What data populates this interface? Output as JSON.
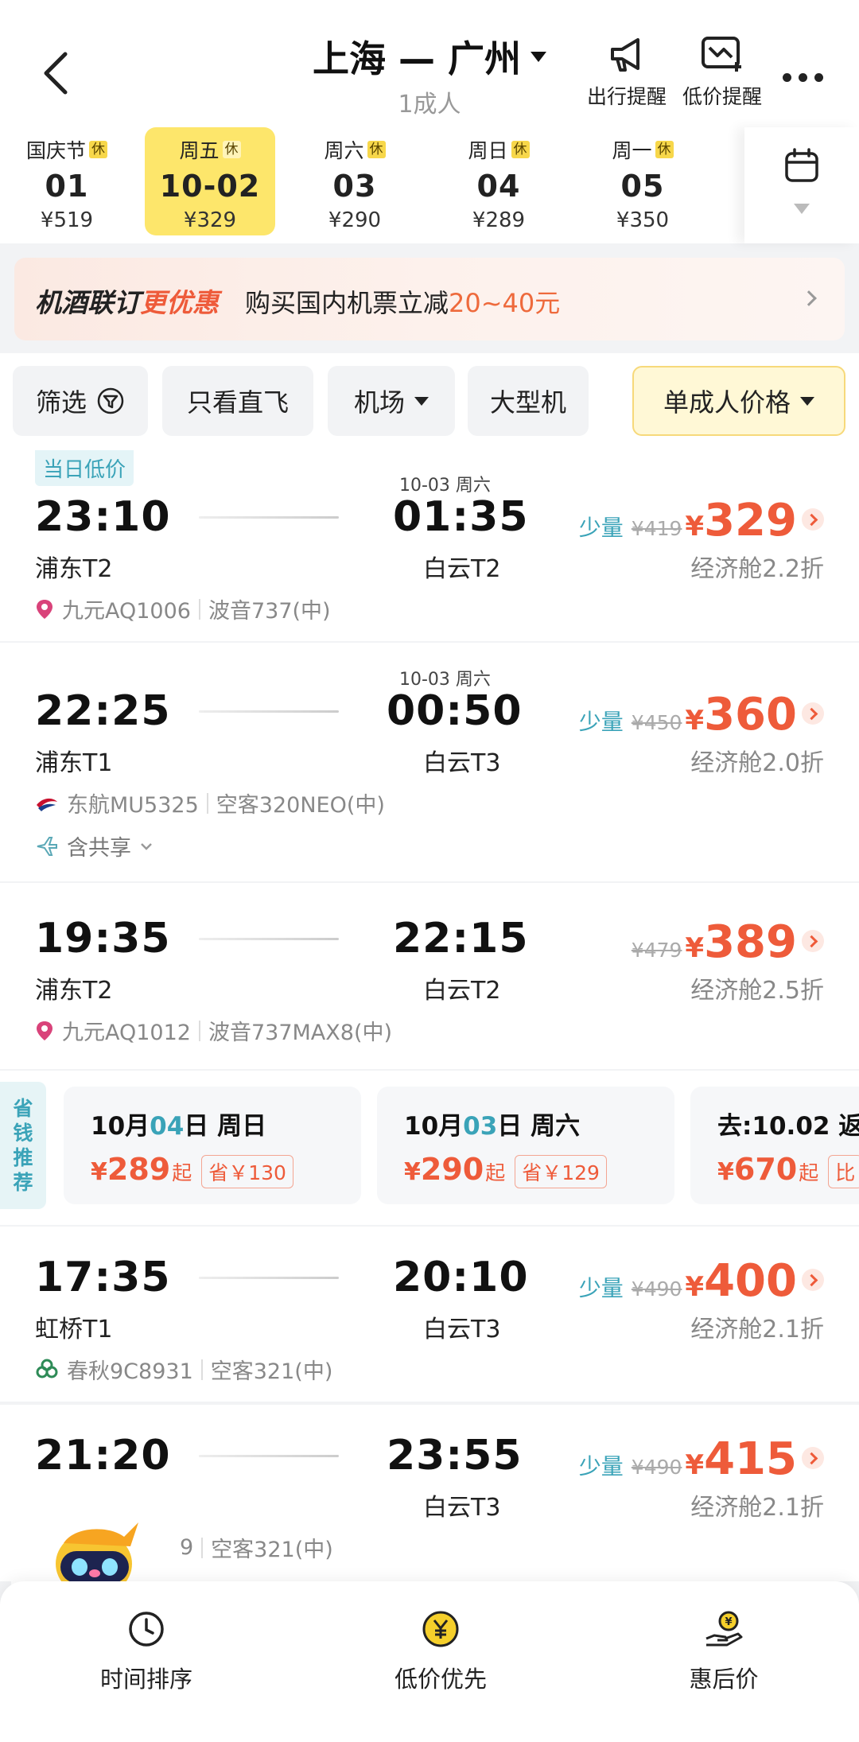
{
  "header": {
    "route": "上海 — 广州",
    "passengers": "1成人",
    "trip_reminder": "出行提醒",
    "price_alert": "低价提醒"
  },
  "dates": [
    {
      "weekday": "国庆节",
      "rest": "休",
      "date": "01",
      "price": "¥519",
      "selected": false
    },
    {
      "weekday": "周五",
      "rest": "休",
      "date": "10-02",
      "price": "¥329",
      "selected": true
    },
    {
      "weekday": "周六",
      "rest": "休",
      "date": "03",
      "price": "¥290",
      "selected": false
    },
    {
      "weekday": "周日",
      "rest": "休",
      "date": "04",
      "price": "¥289",
      "selected": false
    },
    {
      "weekday": "周一",
      "rest": "休",
      "date": "05",
      "price": "¥350",
      "selected": false
    }
  ],
  "banner": {
    "title_a": "机酒联订",
    "title_b": "更优惠",
    "text_a": "购买国内机票立减",
    "text_b": "20~40元"
  },
  "filters": {
    "filter": "筛选",
    "direct": "只看直飞",
    "airport": "机场",
    "large": "大型机",
    "adult_price": "单成人价格"
  },
  "flights": [
    {
      "tag": "当日低价",
      "next_day": "10-03 周六",
      "dep": "23:10",
      "dep_term": "浦东T2",
      "arr": "01:35",
      "arr_term": "白云T2",
      "few": "少量",
      "orig": "¥419",
      "yen": "¥",
      "price": "329",
      "cabin": "经济舱2.2折",
      "airline": "九元AQ1006",
      "aircraft": "波音737(中)"
    },
    {
      "next_day": "10-03 周六",
      "dep": "22:25",
      "dep_term": "浦东T1",
      "arr": "00:50",
      "arr_term": "白云T3",
      "few": "少量",
      "orig": "¥450",
      "yen": "¥",
      "price": "360",
      "cabin": "经济舱2.0折",
      "airline": "东航MU5325",
      "aircraft": "空客320NEO(中)",
      "share": "含共享"
    },
    {
      "dep": "19:35",
      "dep_term": "浦东T2",
      "arr": "22:15",
      "arr_term": "白云T2",
      "orig": "¥479",
      "yen": "¥",
      "price": "389",
      "cabin": "经济舱2.5折",
      "airline": "九元AQ1012",
      "aircraft": "波音737MAX8(中)"
    },
    {
      "dep": "17:35",
      "dep_term": "虹桥T1",
      "arr": "20:10",
      "arr_term": "白云T3",
      "few": "少量",
      "orig": "¥490",
      "yen": "¥",
      "price": "400",
      "cabin": "经济舱2.1折",
      "airline": "春秋9C8931",
      "aircraft": "空客321(中)"
    },
    {
      "dep": "21:20",
      "arr": "23:55",
      "arr_term": "白云T3",
      "few": "少量",
      "orig": "¥490",
      "yen": "¥",
      "price": "415",
      "cabin": "经济舱2.1折",
      "airline_tail": "9",
      "aircraft": "空客321(中)"
    }
  ],
  "savings": {
    "label": [
      "省",
      "钱",
      "推",
      "荐"
    ],
    "cards": [
      {
        "m": "10月",
        "d": "04",
        "rest": "日 周日",
        "yen": "¥",
        "price": "289",
        "qi": "起",
        "off": "省￥130"
      },
      {
        "m": "10月",
        "d": "03",
        "rest": "日 周六",
        "yen": "¥",
        "price": "290",
        "qi": "起",
        "off": "省￥129"
      },
      {
        "text": "去:10.02 返",
        "yen": "¥",
        "price": "670",
        "qi": "起",
        "off": "比"
      }
    ]
  },
  "bottom": {
    "time_sort": "时间排序",
    "low_price": "低价优先",
    "discount": "惠后价"
  },
  "colors": {
    "accent": "#ee5b3a",
    "teal": "#3aa3b8",
    "yellow": "#fde66b"
  }
}
